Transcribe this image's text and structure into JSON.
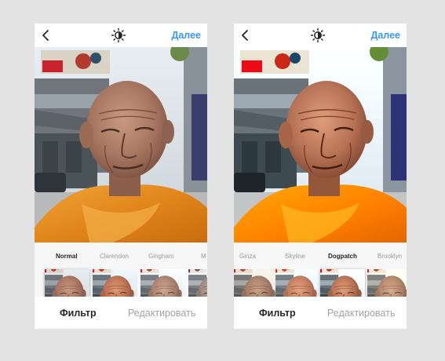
{
  "screens": [
    {
      "header": {
        "next_label": "Далее"
      },
      "filters": [
        "Normal",
        "Clarendon",
        "Gingham",
        "M"
      ],
      "active_filter_index": 0,
      "tabs": {
        "filter": "Фильтр",
        "edit": "Редактировать"
      }
    },
    {
      "header": {
        "next_label": "Далее"
      },
      "filters": [
        "Ginza",
        "Skyline",
        "Dogpatch",
        "Brooklyn"
      ],
      "active_filter_index": 2,
      "tabs": {
        "filter": "Фильтр",
        "edit": "Редактировать"
      }
    }
  ],
  "icons": {
    "back": "chevron-left-icon",
    "lux": "sun-adjust-icon"
  },
  "colors": {
    "accent": "#3897f0",
    "active_text": "#262626",
    "inactive_text": "#a3a3a3",
    "robe": "#e38c1e"
  }
}
